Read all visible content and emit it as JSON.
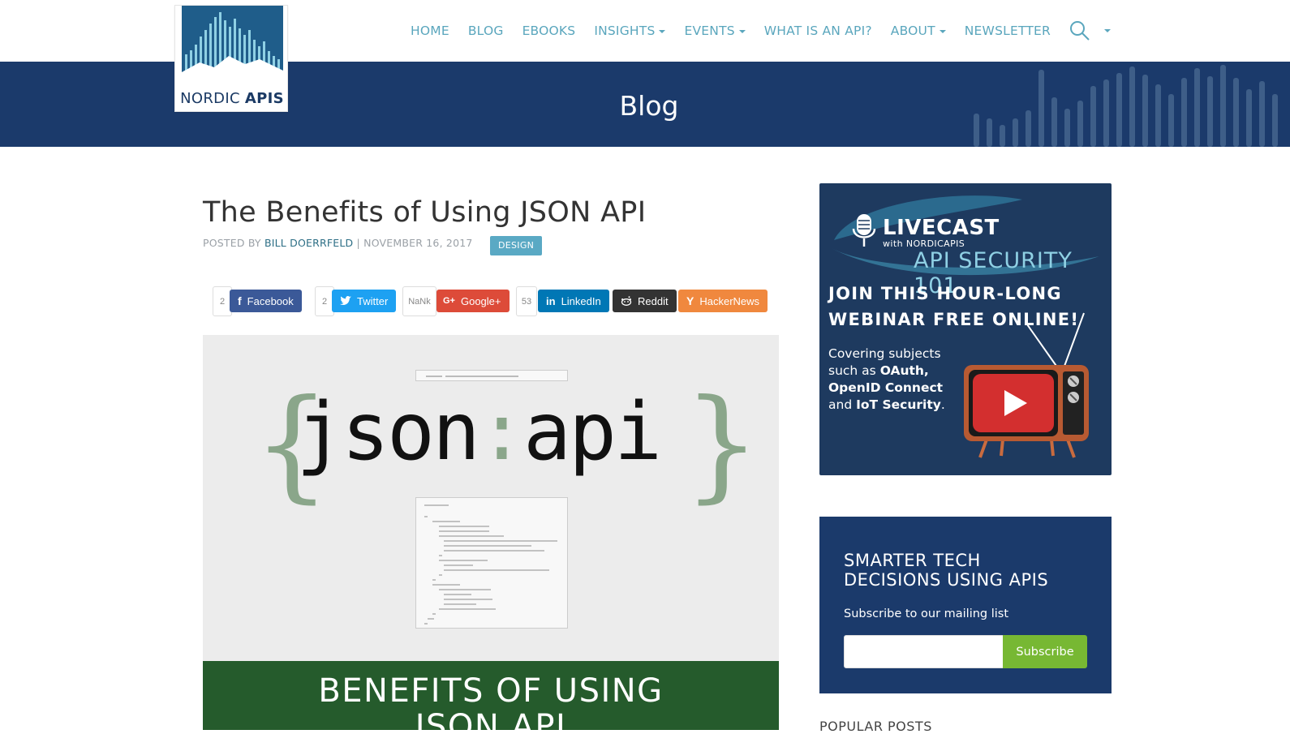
{
  "logo": {
    "text_light": "NORDIC",
    "text_bold": "APIS"
  },
  "nav": {
    "items": [
      {
        "label": "HOME",
        "dropdown": false
      },
      {
        "label": "BLOG",
        "dropdown": false
      },
      {
        "label": "EBOOKS",
        "dropdown": false
      },
      {
        "label": "INSIGHTS",
        "dropdown": true
      },
      {
        "label": "EVENTS",
        "dropdown": true
      },
      {
        "label": "WHAT IS AN API?",
        "dropdown": false
      },
      {
        "label": "ABOUT",
        "dropdown": true
      },
      {
        "label": "NEWSLETTER",
        "dropdown": false
      }
    ],
    "search_icon": "search-icon"
  },
  "banner": {
    "title": "Blog"
  },
  "post": {
    "title": "The Benefits of Using JSON API",
    "posted_by": "POSTED BY",
    "author": "BILL DOERRFELD",
    "separator": "|",
    "date": "NOVEMBER 16, 2017",
    "tag": "DESIGN"
  },
  "shares": {
    "facebook": {
      "count": "2",
      "label": "Facebook"
    },
    "twitter": {
      "count": "2",
      "label": "Twitter"
    },
    "google": {
      "count": "NaNk",
      "label": "Google+"
    },
    "linkedin": {
      "count": "53",
      "label": "LinkedIn"
    },
    "reddit": {
      "label": "Reddit"
    },
    "hackernews": {
      "label": "HackerNews"
    }
  },
  "hero": {
    "brace_open": "{",
    "brace_close": "}",
    "word1": "json",
    "colon": ":",
    "word2": "api",
    "caption_line1": "BENEFITS OF USING",
    "caption_line2": "JSON API"
  },
  "ad": {
    "livecast": "LIVECAST",
    "with": "with NORDICAPIS",
    "security": "API SECURITY 101",
    "join_line1": "JOIN THIS HOUR-LONG",
    "join_line2": "WEBINAR FREE ONLINE!",
    "cover_intro": "Covering subjects such as",
    "cover_topic1": "OAuth, OpenID Connect",
    "cover_and": "and",
    "cover_topic2": "IoT Security",
    "cover_end": "."
  },
  "subscribe": {
    "heading_line1": "SMARTER TECH",
    "heading_line2": "DECISIONS USING APIS",
    "subtitle": "Subscribe to our mailing list",
    "input_value": "",
    "button": "Subscribe"
  },
  "popular": {
    "heading": "POPULAR POSTS"
  },
  "colors": {
    "brand_navy": "#1b3a6b",
    "nav_link": "#5aa6bd",
    "tag_bg": "#5aa9c4",
    "facebook": "#3b5998",
    "twitter": "#1da1f2",
    "google": "#dd4b39",
    "linkedin": "#0077b5",
    "reddit": "#333333",
    "hackernews": "#f0883e",
    "subscribe_button": "#77b833",
    "hero_green": "#255b2c"
  }
}
